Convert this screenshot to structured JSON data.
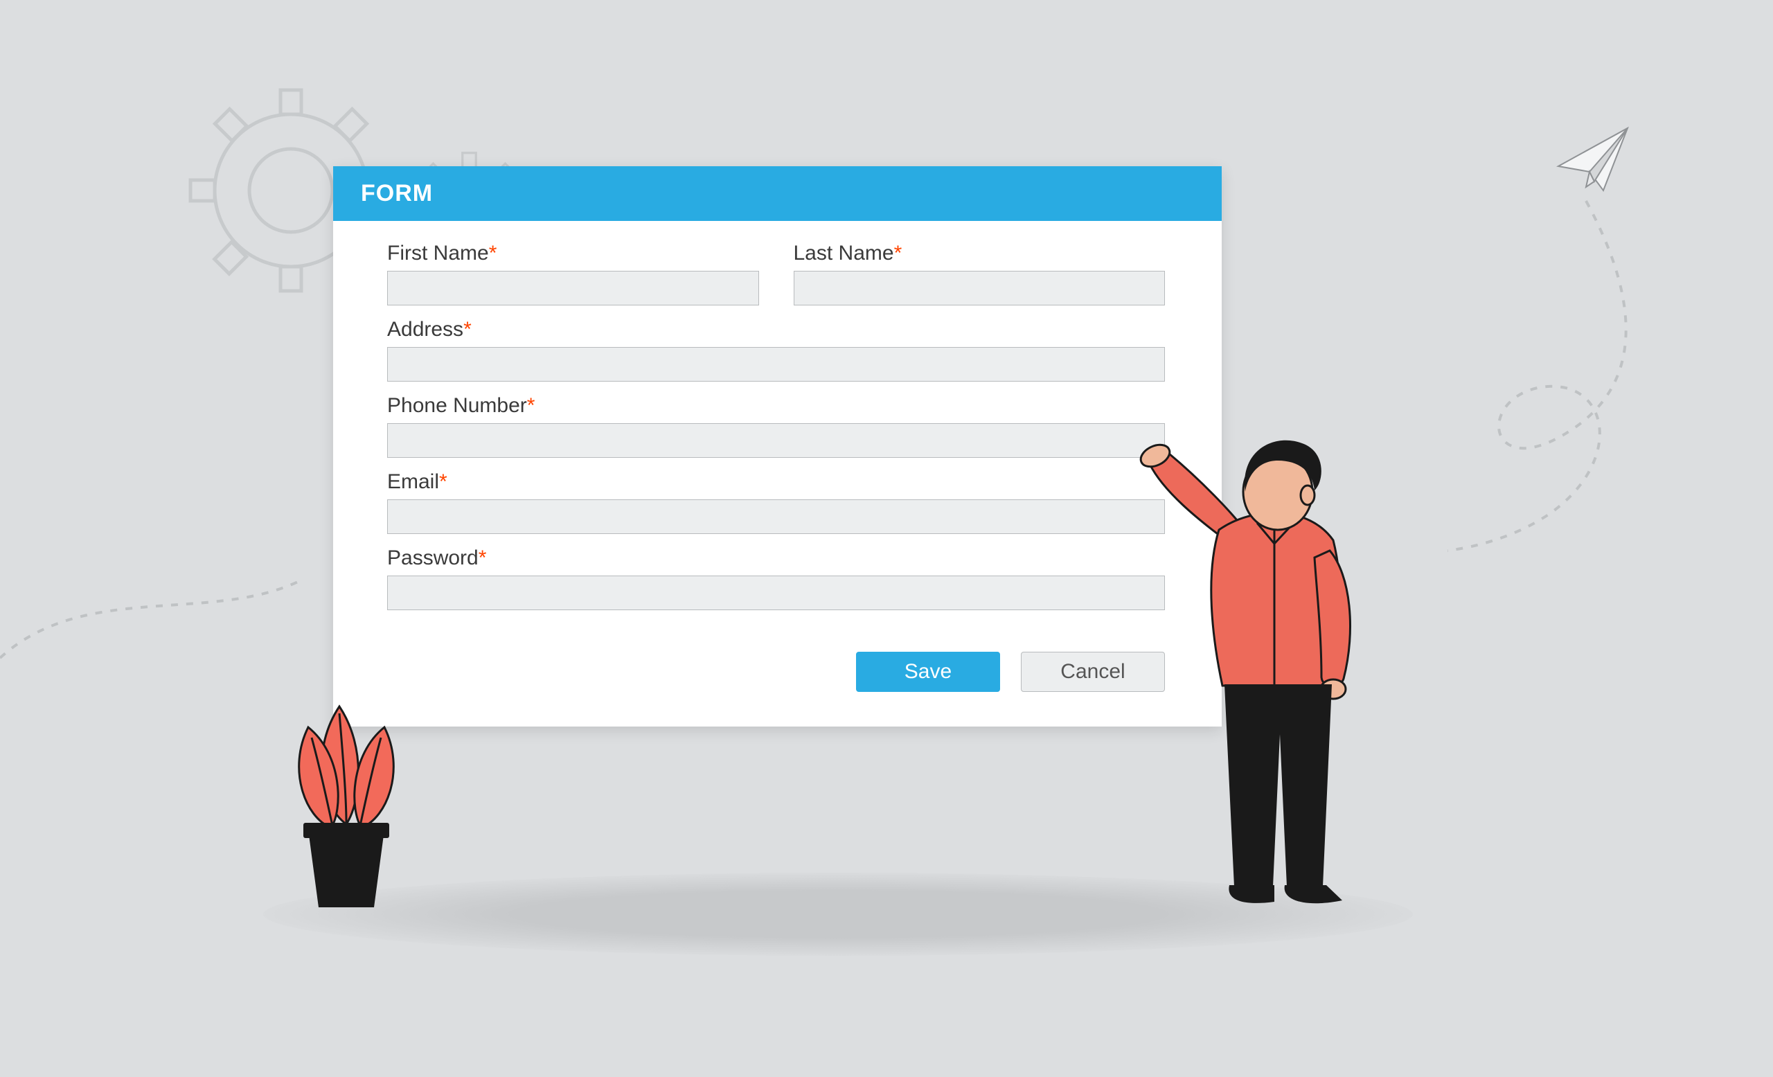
{
  "form": {
    "title": "FORM",
    "fields": {
      "first_name": {
        "label": "First Name",
        "value": ""
      },
      "last_name": {
        "label": "Last Name",
        "value": ""
      },
      "address": {
        "label": "Address",
        "value": ""
      },
      "phone": {
        "label": "Phone Number",
        "value": ""
      },
      "email": {
        "label": "Email",
        "value": ""
      },
      "password": {
        "label": "Password",
        "value": ""
      }
    },
    "required_marker": "*",
    "buttons": {
      "save": "Save",
      "cancel": "Cancel"
    }
  },
  "colors": {
    "accent": "#29abe2",
    "required": "#ff4500",
    "input_bg": "#eceeef"
  }
}
